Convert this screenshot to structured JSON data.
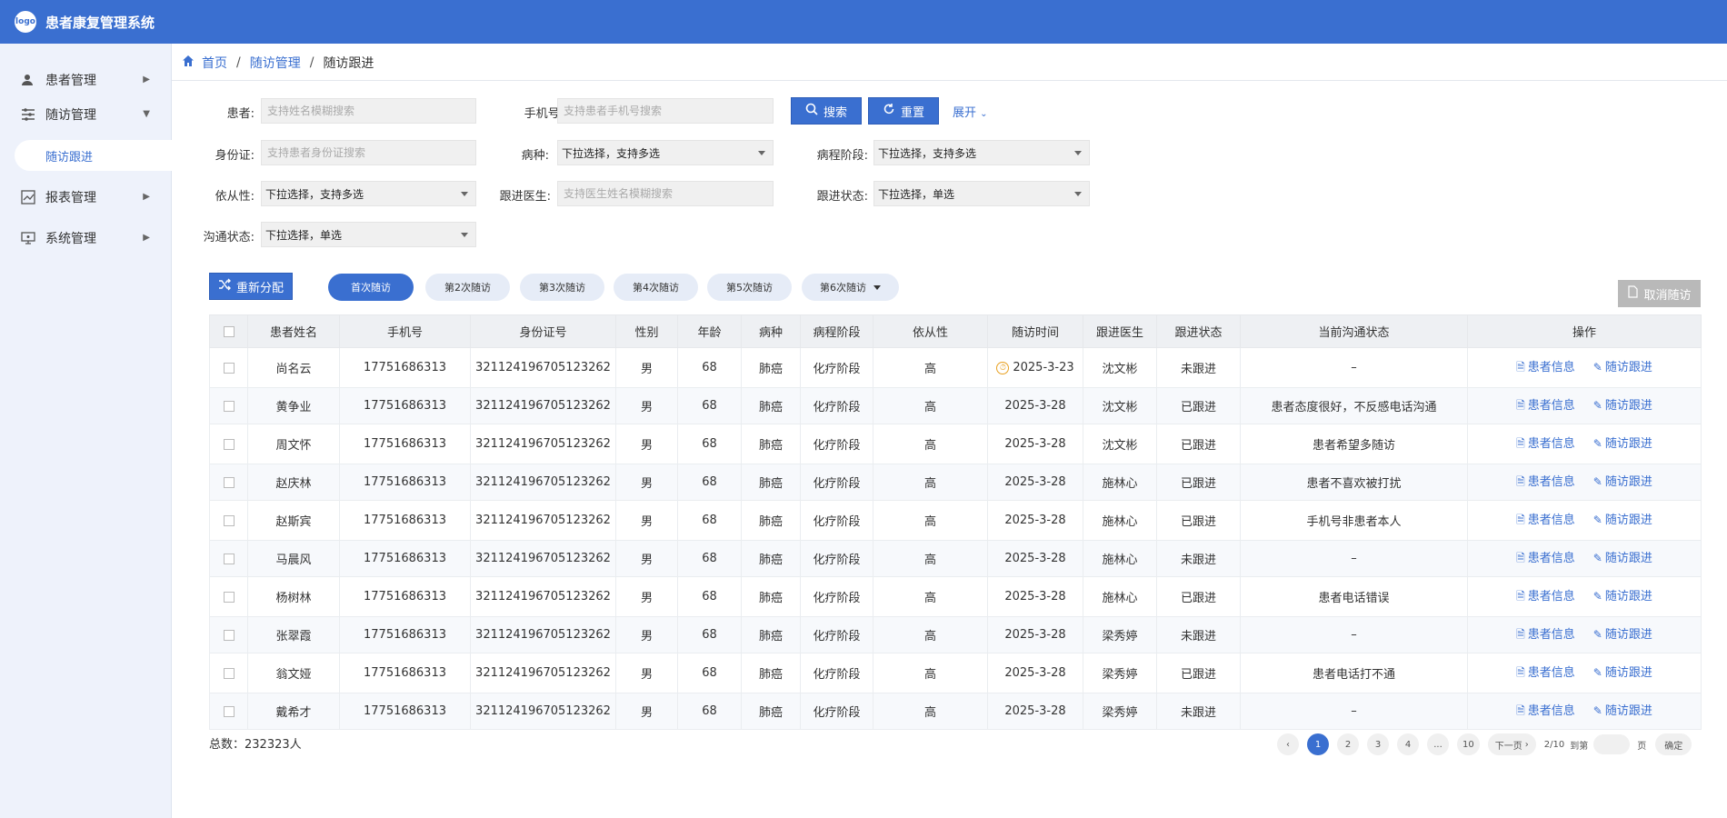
{
  "header": {
    "logo_text": "logo",
    "title": "患者康复管理系统"
  },
  "sidebar": {
    "items": [
      {
        "label": "患者管理",
        "icon": "user-icon"
      },
      {
        "label": "随访管理",
        "icon": "sliders-icon"
      },
      {
        "label": "报表管理",
        "icon": "chart-icon"
      },
      {
        "label": "系统管理",
        "icon": "monitor-icon"
      }
    ],
    "sub_active": "随访跟进"
  },
  "breadcrumb": {
    "home": "首页",
    "level2": "随访管理",
    "current": "随访跟进"
  },
  "filters": {
    "patient": {
      "label": "患者:",
      "placeholder": "支持姓名模糊搜索"
    },
    "phone": {
      "label": "手机号:",
      "placeholder": "支持患者手机号搜索"
    },
    "idcard": {
      "label": "身份证:",
      "placeholder": "支持患者身份证搜索"
    },
    "disease": {
      "label": "病种:",
      "value": "下拉选择，支持多选"
    },
    "stage": {
      "label": "病程阶段:",
      "value": "下拉选择，支持多选"
    },
    "compliance": {
      "label": "依从性:",
      "value": "下拉选择，支持多选"
    },
    "doctor": {
      "label": "跟进医生:",
      "placeholder": "支持医生姓名模糊搜索"
    },
    "follow_status": {
      "label": "跟进状态:",
      "value": "下拉选择，单选"
    },
    "comm_status": {
      "label": "沟通状态:",
      "value": "下拉选择，单选"
    }
  },
  "actions": {
    "search": "搜索",
    "reset": "重置",
    "expand": "展开",
    "reassign": "重新分配",
    "cancel_followup": "取消随访"
  },
  "tabs": [
    "首次随访",
    "第2次随访",
    "第3次随访",
    "第4次随访",
    "第5次随访",
    "第6次随访"
  ],
  "table": {
    "columns": [
      "患者姓名",
      "手机号",
      "身份证号",
      "性别",
      "年龄",
      "病种",
      "病程阶段",
      "依从性",
      "随访时间",
      "跟进医生",
      "跟进状态",
      "当前沟通状态",
      "操作"
    ],
    "op_info": "患者信息",
    "op_follow": "随访跟进",
    "rows": [
      {
        "name": "尚名云",
        "phone": "17751686313",
        "id": "321124196705123262",
        "sex": "男",
        "age": "68",
        "disease": "肺癌",
        "stage": "化疗阶段",
        "comp": "高",
        "date": "2025-3-23",
        "doctor": "沈文彬",
        "status": "未跟进",
        "comm": "–"
      },
      {
        "name": "黄争业",
        "phone": "17751686313",
        "id": "321124196705123262",
        "sex": "男",
        "age": "68",
        "disease": "肺癌",
        "stage": "化疗阶段",
        "comp": "高",
        "date": "2025-3-28",
        "doctor": "沈文彬",
        "status": "已跟进",
        "comm": "患者态度很好，不反感电话沟通"
      },
      {
        "name": "周文怀",
        "phone": "17751686313",
        "id": "321124196705123262",
        "sex": "男",
        "age": "68",
        "disease": "肺癌",
        "stage": "化疗阶段",
        "comp": "高",
        "date": "2025-3-28",
        "doctor": "沈文彬",
        "status": "已跟进",
        "comm": "患者希望多随访"
      },
      {
        "name": "赵庆林",
        "phone": "17751686313",
        "id": "321124196705123262",
        "sex": "男",
        "age": "68",
        "disease": "肺癌",
        "stage": "化疗阶段",
        "comp": "高",
        "date": "2025-3-28",
        "doctor": "施林心",
        "status": "已跟进",
        "comm": "患者不喜欢被打扰"
      },
      {
        "name": "赵斯宾",
        "phone": "17751686313",
        "id": "321124196705123262",
        "sex": "男",
        "age": "68",
        "disease": "肺癌",
        "stage": "化疗阶段",
        "comp": "高",
        "date": "2025-3-28",
        "doctor": "施林心",
        "status": "已跟进",
        "comm": "手机号非患者本人"
      },
      {
        "name": "马晨风",
        "phone": "17751686313",
        "id": "321124196705123262",
        "sex": "男",
        "age": "68",
        "disease": "肺癌",
        "stage": "化疗阶段",
        "comp": "高",
        "date": "2025-3-28",
        "doctor": "施林心",
        "status": "未跟进",
        "comm": "–"
      },
      {
        "name": "杨树林",
        "phone": "17751686313",
        "id": "321124196705123262",
        "sex": "男",
        "age": "68",
        "disease": "肺癌",
        "stage": "化疗阶段",
        "comp": "高",
        "date": "2025-3-28",
        "doctor": "施林心",
        "status": "已跟进",
        "comm": "患者电话错误"
      },
      {
        "name": "张翠霞",
        "phone": "17751686313",
        "id": "321124196705123262",
        "sex": "男",
        "age": "68",
        "disease": "肺癌",
        "stage": "化疗阶段",
        "comp": "高",
        "date": "2025-3-28",
        "doctor": "梁秀婷",
        "status": "未跟进",
        "comm": "–"
      },
      {
        "name": "翁文娅",
        "phone": "17751686313",
        "id": "321124196705123262",
        "sex": "男",
        "age": "68",
        "disease": "肺癌",
        "stage": "化疗阶段",
        "comp": "高",
        "date": "2025-3-28",
        "doctor": "梁秀婷",
        "status": "已跟进",
        "comm": "患者电话打不通"
      },
      {
        "name": "戴希才",
        "phone": "17751686313",
        "id": "321124196705123262",
        "sex": "男",
        "age": "68",
        "disease": "肺癌",
        "stage": "化疗阶段",
        "comp": "高",
        "date": "2025-3-28",
        "doctor": "梁秀婷",
        "status": "未跟进",
        "comm": "–"
      }
    ]
  },
  "footer": {
    "total": "总数：232323人",
    "pages": [
      "1",
      "2",
      "3",
      "4",
      "...",
      "10"
    ],
    "next": "下一页",
    "page_info": "2/10",
    "goto": "到第",
    "page_unit": "页",
    "confirm": "确定"
  },
  "colors": {
    "primary": "#3a6fd0",
    "sidebar_bg": "#eef2fb",
    "remind": "#e8a020"
  }
}
